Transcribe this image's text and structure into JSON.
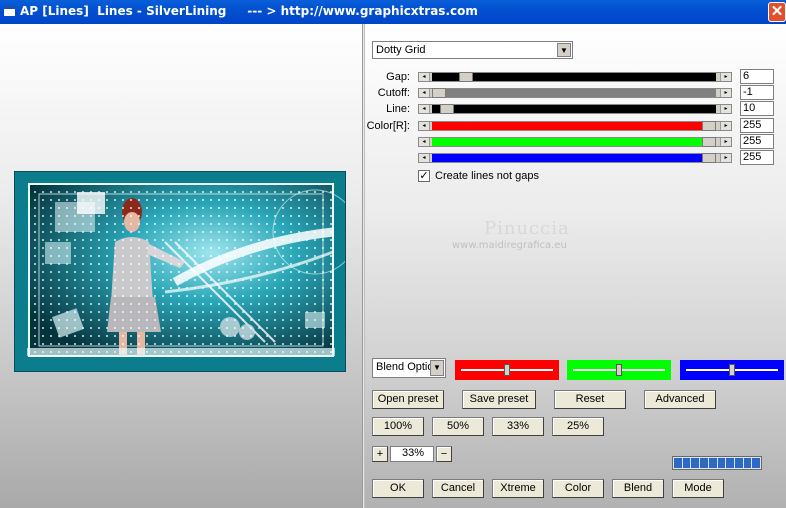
{
  "window": {
    "title": "AP [Lines]  Lines - SilverLining     --- > http://www.graphicxtras.com",
    "close_icon": "close-icon"
  },
  "preset_select": {
    "value": "Dotty Grid"
  },
  "sliders": [
    {
      "label": "Gap:",
      "value": "6",
      "fill": "#000000",
      "level": 0.1
    },
    {
      "label": "Cutoff:",
      "value": "-1",
      "fill": "#808080",
      "level": 0.0
    },
    {
      "label": "Line:",
      "value": "10",
      "fill": "#000000",
      "level": 0.03
    },
    {
      "label": "Color[R]:",
      "value": "255",
      "fill": "#ff0000",
      "level": 1.0
    },
    {
      "label": "",
      "value": "255",
      "fill": "#00ff00",
      "level": 1.0
    },
    {
      "label": "",
      "value": "255",
      "fill": "#0000ff",
      "level": 1.0
    }
  ],
  "checkbox": {
    "label": "Create lines not gaps",
    "checked": "✓"
  },
  "watermark": {
    "name": "Pinuccia",
    "url": "www.maidiregrafica.eu"
  },
  "blend_select": {
    "value": "Blend Optio"
  },
  "color_boxes": [
    {
      "color": "#ff0000",
      "level": 0.5
    },
    {
      "color": "#00ff00",
      "level": 0.5
    },
    {
      "color": "#0000ff",
      "level": 0.5
    }
  ],
  "buttons": {
    "open_preset": "Open preset",
    "save_preset": "Save preset",
    "reset": "Reset",
    "advanced": "Advanced",
    "z100": "100%",
    "z50": "50%",
    "z33": "33%",
    "z25": "25%",
    "ok": "OK",
    "cancel": "Cancel",
    "xtreme": "Xtreme",
    "color": "Color",
    "blend": "Blend",
    "mode": "Mode"
  },
  "zoom": {
    "plus": "+",
    "minus": "−",
    "value": "33%"
  },
  "progress_segments": 10
}
